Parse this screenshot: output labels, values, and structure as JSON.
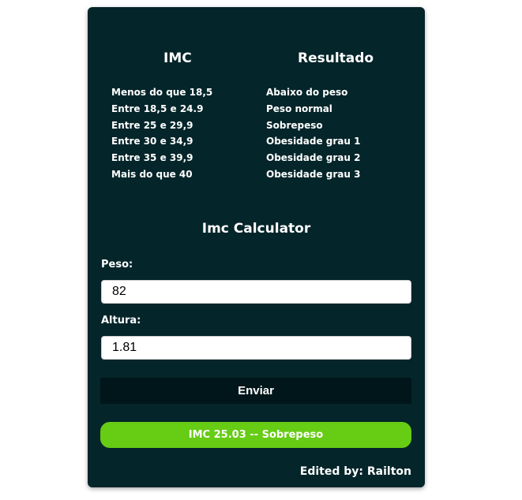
{
  "table": {
    "header_imc": "IMC",
    "header_resultado": "Resultado",
    "rows": [
      {
        "imc": "Menos do que 18,5",
        "resultado": "Abaixo do peso"
      },
      {
        "imc": "Entre 18,5 e 24.9",
        "resultado": "Peso normal"
      },
      {
        "imc": "Entre 25 e 29,9",
        "resultado": "Sobrepeso"
      },
      {
        "imc": "Entre 30 e 34,9",
        "resultado": "Obesidade grau 1"
      },
      {
        "imc": "Entre 35 e 39,9",
        "resultado": "Obesidade grau 2"
      },
      {
        "imc": "Mais do que 40",
        "resultado": "Obesidade grau 3"
      }
    ]
  },
  "calculator": {
    "title": "Imc Calculator",
    "peso_label": "Peso:",
    "peso_value": "82",
    "altura_label": "Altura:",
    "altura_value": "1.81",
    "submit_label": "Enviar",
    "result_text": "IMC 25.03 -- Sobrepeso"
  },
  "footer": {
    "credit": "Edited by: Railton"
  },
  "colors": {
    "card_bg": "#04252a",
    "button_bg": "#01161a",
    "result_bg": "#66cc14"
  }
}
